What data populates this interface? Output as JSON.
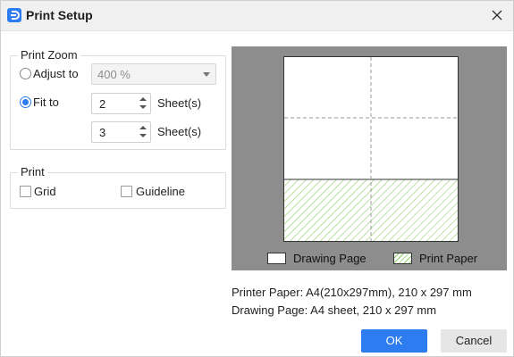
{
  "window": {
    "title": "Print Setup",
    "icon": "edraw-logo-icon",
    "close_icon": "close-icon"
  },
  "print_zoom": {
    "legend": "Print Zoom",
    "adjust_to": {
      "label": "Adjust to",
      "selected": false,
      "value": "400 %"
    },
    "fit_to": {
      "label": "Fit to",
      "selected": true,
      "sheets_wide": "2",
      "sheets_high": "3",
      "unit_label": "Sheet(s)"
    }
  },
  "print_group": {
    "legend": "Print",
    "grid": {
      "label": "Grid",
      "checked": false
    },
    "guideline": {
      "label": "Guideline",
      "checked": false
    }
  },
  "preview": {
    "legend_drawing_page": "Drawing Page",
    "legend_print_paper": "Print Paper",
    "hatch_color": "#8fce6a",
    "background_color": "#8d8d8d"
  },
  "info": {
    "printer_paper": "Printer Paper: A4(210x297mm), 210 x 297 mm",
    "drawing_page": "Drawing Page: A4 sheet, 210 x 297 mm"
  },
  "buttons": {
    "ok": "OK",
    "cancel": "Cancel"
  },
  "colors": {
    "accent": "#2d7cf0"
  }
}
